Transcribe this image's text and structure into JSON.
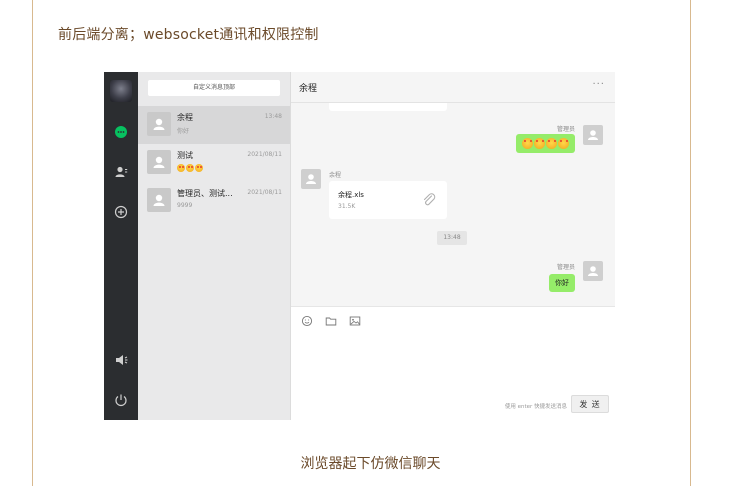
{
  "article": {
    "title": "前后端分离；websocket通讯和权限控制",
    "caption": "浏览器起下仿微信聊天"
  },
  "app": {
    "list": {
      "custom_button_label": "自定义消息顶部",
      "conversations": [
        {
          "name": "余程",
          "preview": "你好",
          "time": "13:48",
          "active": true
        },
        {
          "name": "测试",
          "preview": "",
          "time": "2021/08/11",
          "emoji_count": 3,
          "active": false
        },
        {
          "name": "管理员、测试...",
          "preview": "9999",
          "time": "2021/08/11",
          "active": false
        }
      ]
    },
    "chat": {
      "title": "余程",
      "more": "···",
      "messages": {
        "m1_sender": "管理员",
        "m1_emoji_count": 4,
        "m2_sender": "余程",
        "file_name": "余程.xls",
        "file_size": "31.5K",
        "time_divider": "13:48",
        "m3_sender": "管理员",
        "m3_text": "你好"
      },
      "composer": {
        "hint": "使用 enter 快捷发送消息",
        "send_label": "发 送"
      }
    },
    "colors": {
      "nav_bg": "#2b2d30",
      "accent_green": "#07c160",
      "bubble_green": "#95ec69"
    },
    "icons": [
      "chat-icon",
      "contacts-icon",
      "add-icon",
      "speaker-icon",
      "power-icon",
      "emoji-icon",
      "folder-icon",
      "image-icon",
      "paperclip-icon"
    ]
  }
}
